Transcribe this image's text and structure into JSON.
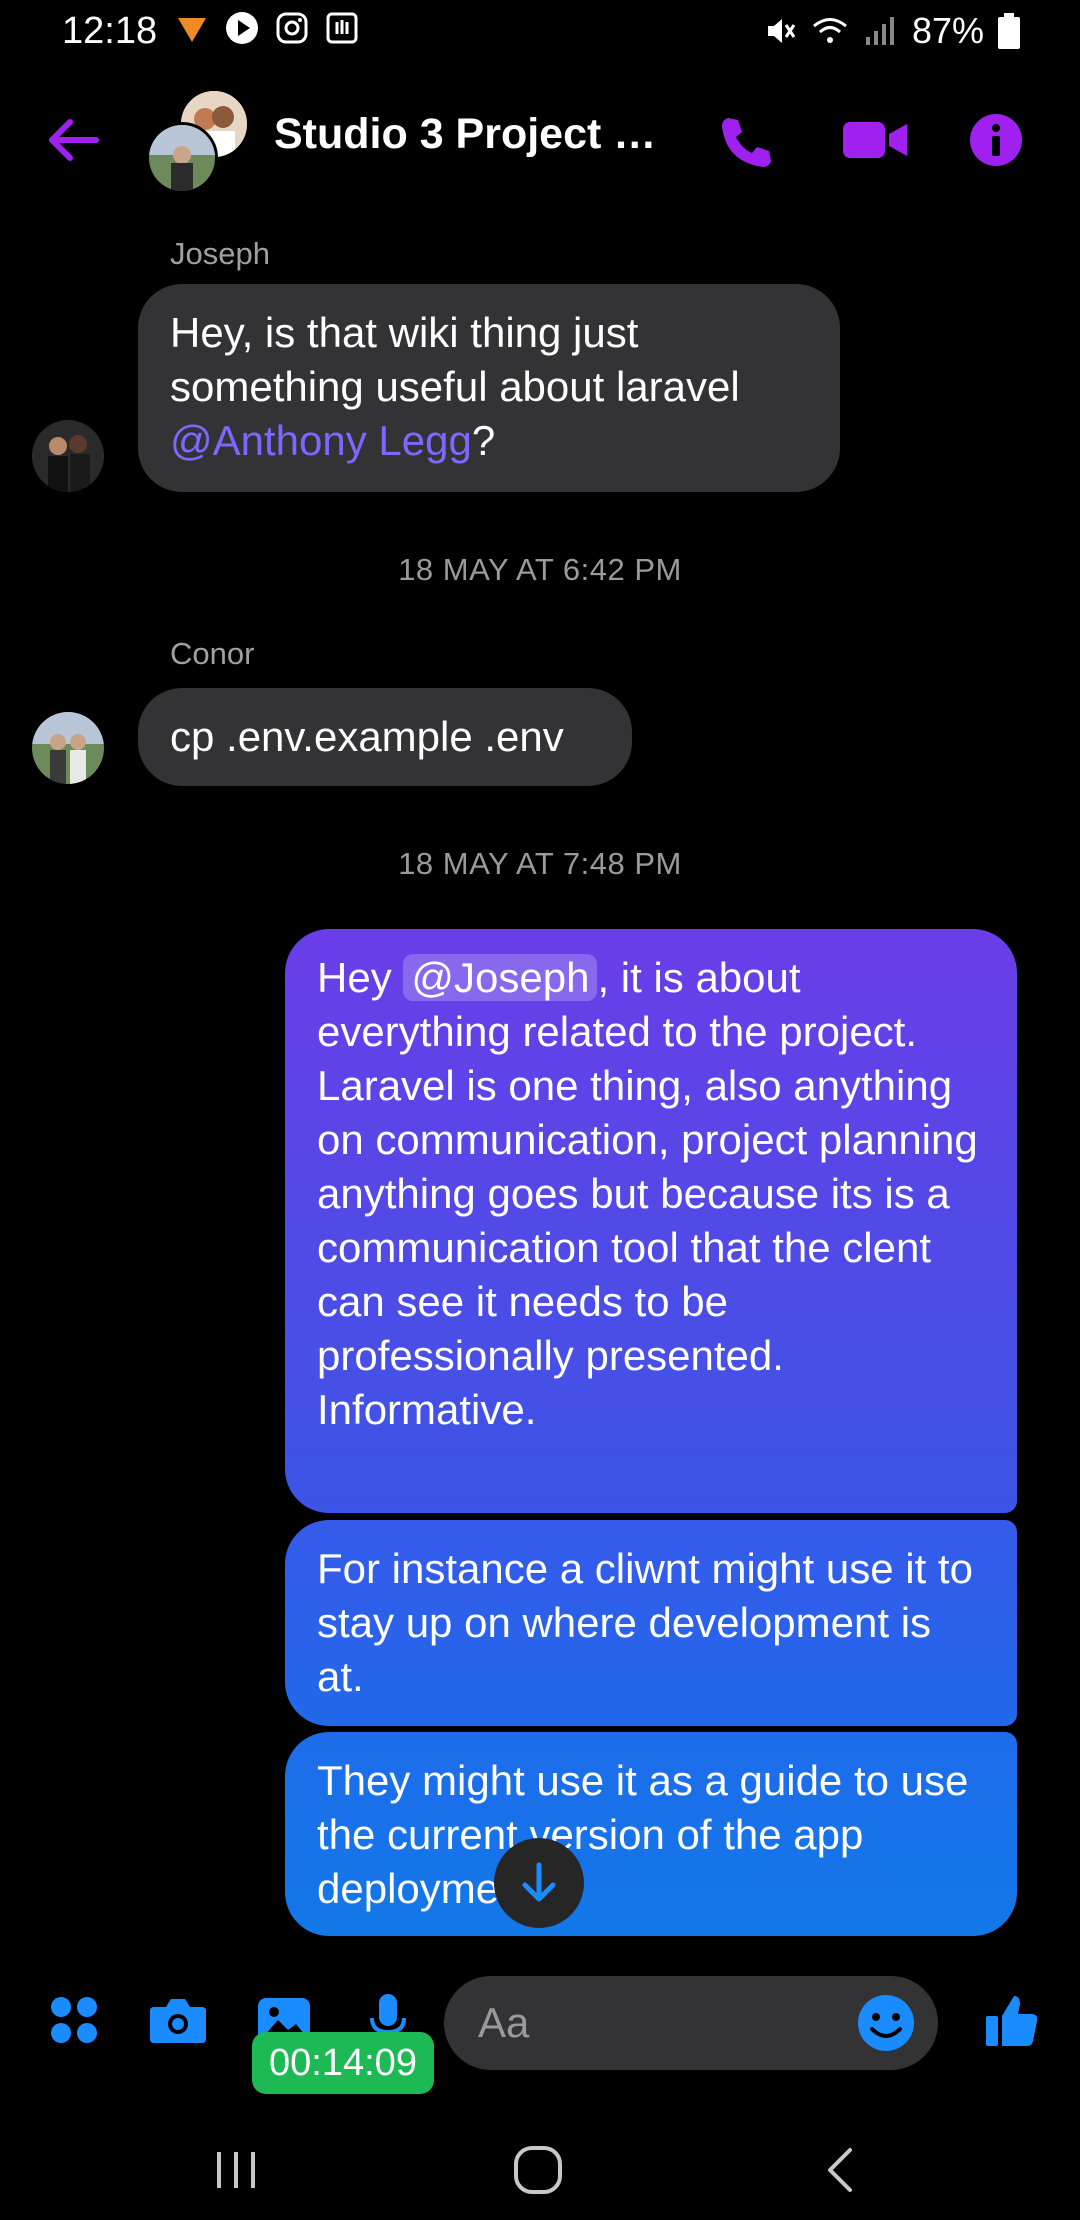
{
  "status_bar": {
    "time": "12:18",
    "battery": "87%"
  },
  "header": {
    "title": "Studio 3 Project T…",
    "icons": [
      "back-arrow-icon",
      "phone-icon",
      "video-camera-icon",
      "info-icon"
    ],
    "accent_color": "#a020f0"
  },
  "messages": [
    {
      "sender": "Joseph",
      "text_before": "Hey, is that wiki thing just something useful about laravel ",
      "mention": "@Anthony Legg",
      "text_after": "?"
    },
    {
      "timestamp": "18 MAY AT 6:42 PM"
    },
    {
      "sender": "Conor",
      "text": "cp .env.example .env"
    },
    {
      "timestamp": "18 MAY AT 7:48 PM"
    },
    {
      "outgoing": true,
      "text_before": "Hey ",
      "mention": "@Joseph",
      "text_after": ", it is about everything related to the project. Laravel is one thing, also anything on communication, project planning anything goes but because its is a communication tool that the clent can see it needs to be professionally presented. Informative."
    },
    {
      "outgoing": true,
      "text": "For instance a cliwnt might use it to stay up on where development is at."
    },
    {
      "outgoing": true,
      "text": "They might use it as a guide to use the current version of the app deployment."
    }
  ],
  "composer": {
    "placeholder": "Aa",
    "timer": "00:14:09",
    "icons": [
      "apps-icon",
      "camera-icon",
      "gallery-icon",
      "microphone-icon",
      "emoji-icon",
      "thumbs-up-icon"
    ]
  },
  "colors": {
    "bubble_in": "#333336",
    "out_gradient_top": "#6a3de8",
    "out_gradient_bottom": "#1278e8",
    "composer_blue": "#1a8cff",
    "timer_green": "#1db954"
  }
}
